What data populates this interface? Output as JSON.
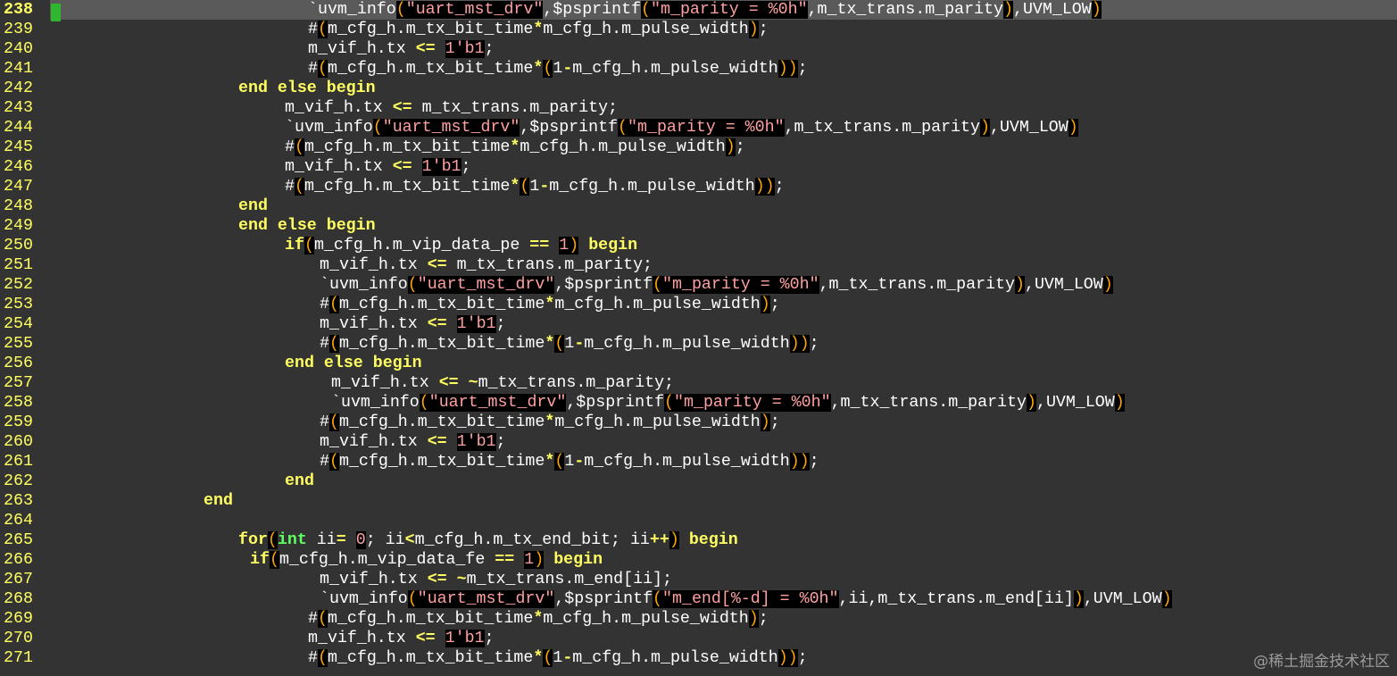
{
  "editor": {
    "current_line": 238,
    "colors": {
      "background": "#333333",
      "current_line_background": "#5a5a5a",
      "line_number": "#ffff60",
      "keyword": "#ffff60",
      "type": "#60ff60",
      "paren": "#ffa500",
      "string": "#ffa0a0",
      "sign_marker": "#2fb82f"
    },
    "lines": [
      {
        "num": "238",
        "indent": 21,
        "tokens": [
          [
            "mac",
            "`uvm_info"
          ],
          [
            "pr",
            "("
          ],
          [
            "str",
            "\"uart_mst_drv\""
          ],
          [
            "",
            "",
            ""
          ],
          [
            "",
            ",$psprintf"
          ],
          [
            "pr",
            "("
          ],
          [
            "str",
            "\"m_parity = %0h\""
          ],
          [
            "",
            ",m_tx_trans.m_parity"
          ],
          [
            "pr",
            ")"
          ],
          [
            "",
            ",UVM_LOW"
          ],
          [
            "pr",
            ")"
          ]
        ]
      },
      {
        "num": "239",
        "indent": 21,
        "tokens": [
          [
            "",
            "#"
          ],
          [
            "pr",
            "("
          ],
          [
            "",
            "m_cfg_h.m_tx_bit_time"
          ],
          [
            "op",
            "*"
          ],
          [
            "",
            "m_cfg_h.m_pulse_width"
          ],
          [
            "pr",
            ")"
          ],
          [
            "",
            ";"
          ]
        ]
      },
      {
        "num": "240",
        "indent": 21,
        "tokens": [
          [
            "",
            "m_vif_h.tx "
          ],
          [
            "op",
            "<="
          ],
          [
            "",
            ""
          ],
          [
            "",
            " "
          ],
          [
            "num",
            "1'b1"
          ],
          [
            "",
            ";"
          ]
        ]
      },
      {
        "num": "241",
        "indent": 21,
        "tokens": [
          [
            "",
            "#"
          ],
          [
            "pr",
            "("
          ],
          [
            "",
            "m_cfg_h.m_tx_bit_time"
          ],
          [
            "op",
            "*"
          ],
          [
            "pr",
            "("
          ],
          [
            "",
            "1"
          ],
          [
            "op",
            "-"
          ],
          [
            "",
            "m_cfg_h.m_pulse_width"
          ],
          [
            "pr",
            "))"
          ],
          [
            "",
            ";"
          ]
        ]
      },
      {
        "num": "242",
        "indent": 15,
        "tokens": [
          [
            "kw",
            "end else begin"
          ]
        ]
      },
      {
        "num": "243",
        "indent": 19,
        "tokens": [
          [
            "",
            "m_vif_h.tx "
          ],
          [
            "op",
            "<="
          ],
          [
            "",
            " m_tx_trans.m_parity;"
          ]
        ]
      },
      {
        "num": "244",
        "indent": 19,
        "tokens": [
          [
            "mac",
            "`uvm_info"
          ],
          [
            "pr",
            "("
          ],
          [
            "str",
            "\"uart_mst_drv\""
          ],
          [
            "",
            ",$psprintf"
          ],
          [
            "pr",
            "("
          ],
          [
            "str",
            "\"m_parity = %0h\""
          ],
          [
            "",
            ",m_tx_trans.m_parity"
          ],
          [
            "pr",
            ")"
          ],
          [
            "",
            ",UVM_LOW"
          ],
          [
            "pr",
            ")"
          ]
        ]
      },
      {
        "num": "245",
        "indent": 19,
        "tokens": [
          [
            "",
            "#"
          ],
          [
            "pr",
            "("
          ],
          [
            "",
            "m_cfg_h.m_tx_bit_time"
          ],
          [
            "op",
            "*"
          ],
          [
            "",
            "m_cfg_h.m_pulse_width"
          ],
          [
            "pr",
            ")"
          ],
          [
            "",
            ";"
          ]
        ]
      },
      {
        "num": "246",
        "indent": 19,
        "tokens": [
          [
            "",
            "m_vif_h.tx "
          ],
          [
            "op",
            "<="
          ],
          [
            "",
            " "
          ],
          [
            "num",
            "1'b1"
          ],
          [
            "",
            ";"
          ]
        ]
      },
      {
        "num": "247",
        "indent": 19,
        "tokens": [
          [
            "",
            "#"
          ],
          [
            "pr",
            "("
          ],
          [
            "",
            "m_cfg_h.m_tx_bit_time"
          ],
          [
            "op",
            "*"
          ],
          [
            "pr",
            "("
          ],
          [
            "",
            "1"
          ],
          [
            "op",
            "-"
          ],
          [
            "",
            "m_cfg_h.m_pulse_width"
          ],
          [
            "pr",
            "))"
          ],
          [
            "",
            ";"
          ]
        ]
      },
      {
        "num": "248",
        "indent": 15,
        "tokens": [
          [
            "kw",
            "end"
          ]
        ]
      },
      {
        "num": "249",
        "indent": 15,
        "tokens": [
          [
            "kw",
            "end else begin"
          ]
        ]
      },
      {
        "num": "250",
        "indent": 19,
        "tokens": [
          [
            "kw",
            "if"
          ],
          [
            "pr",
            "("
          ],
          [
            "",
            "m_cfg_h.m_vip_data_pe "
          ],
          [
            "op",
            "=="
          ],
          [
            "",
            " "
          ],
          [
            "num",
            "1"
          ],
          [
            "pr",
            ")"
          ],
          [
            "",
            " "
          ],
          [
            "kw",
            "begin"
          ]
        ]
      },
      {
        "num": "251",
        "indent": 22,
        "tokens": [
          [
            "",
            "m_vif_h.tx "
          ],
          [
            "op",
            "<="
          ],
          [
            "",
            " m_tx_trans.m_parity;"
          ]
        ]
      },
      {
        "num": "252",
        "indent": 22,
        "tokens": [
          [
            "mac",
            "`uvm_info"
          ],
          [
            "pr",
            "("
          ],
          [
            "str",
            "\"uart_mst_drv\""
          ],
          [
            "",
            ",$psprintf"
          ],
          [
            "pr",
            "("
          ],
          [
            "str",
            "\"m_parity = %0h\""
          ],
          [
            "",
            ",m_tx_trans.m_parity"
          ],
          [
            "pr",
            ")"
          ],
          [
            "",
            ",UVM_LOW"
          ],
          [
            "pr",
            ")"
          ]
        ]
      },
      {
        "num": "253",
        "indent": 22,
        "tokens": [
          [
            "",
            "#"
          ],
          [
            "pr",
            "("
          ],
          [
            "",
            "m_cfg_h.m_tx_bit_time"
          ],
          [
            "op",
            "*"
          ],
          [
            "",
            "m_cfg_h.m_pulse_width"
          ],
          [
            "pr",
            ")"
          ],
          [
            "",
            ";"
          ]
        ]
      },
      {
        "num": "254",
        "indent": 22,
        "tokens": [
          [
            "",
            "m_vif_h.tx "
          ],
          [
            "op",
            "<="
          ],
          [
            "",
            " "
          ],
          [
            "num",
            "1'b1"
          ],
          [
            "",
            ";"
          ]
        ]
      },
      {
        "num": "255",
        "indent": 22,
        "tokens": [
          [
            "",
            "#"
          ],
          [
            "pr",
            "("
          ],
          [
            "",
            "m_cfg_h.m_tx_bit_time"
          ],
          [
            "op",
            "*"
          ],
          [
            "pr",
            "("
          ],
          [
            "",
            "1"
          ],
          [
            "op",
            "-"
          ],
          [
            "",
            "m_cfg_h.m_pulse_width"
          ],
          [
            "pr",
            "))"
          ],
          [
            "",
            ";"
          ]
        ]
      },
      {
        "num": "256",
        "indent": 19,
        "tokens": [
          [
            "kw",
            "end else begin"
          ]
        ]
      },
      {
        "num": "257",
        "indent": 23,
        "tokens": [
          [
            "",
            "m_vif_h.tx "
          ],
          [
            "op",
            "<="
          ],
          [
            "",
            " "
          ],
          [
            "op",
            "~"
          ],
          [
            "",
            "m_tx_trans.m_parity;"
          ]
        ]
      },
      {
        "num": "258",
        "indent": 23,
        "tokens": [
          [
            "mac",
            "`uvm_info"
          ],
          [
            "pr",
            "("
          ],
          [
            "str",
            "\"uart_mst_drv\""
          ],
          [
            "",
            ",$psprintf"
          ],
          [
            "pr",
            "("
          ],
          [
            "str",
            "\"m_parity = %0h\""
          ],
          [
            "",
            ",m_tx_trans.m_parity"
          ],
          [
            "pr",
            ")"
          ],
          [
            "",
            ",UVM_LOW"
          ],
          [
            "pr",
            ")"
          ]
        ]
      },
      {
        "num": "259",
        "indent": 22,
        "tokens": [
          [
            "",
            "#"
          ],
          [
            "pr",
            "("
          ],
          [
            "",
            "m_cfg_h.m_tx_bit_time"
          ],
          [
            "op",
            "*"
          ],
          [
            "",
            "m_cfg_h.m_pulse_width"
          ],
          [
            "pr",
            ")"
          ],
          [
            "",
            ";"
          ]
        ]
      },
      {
        "num": "260",
        "indent": 22,
        "tokens": [
          [
            "",
            "m_vif_h.tx "
          ],
          [
            "op",
            "<="
          ],
          [
            "",
            " "
          ],
          [
            "num",
            "1'b1"
          ],
          [
            "",
            ";"
          ]
        ]
      },
      {
        "num": "261",
        "indent": 22,
        "tokens": [
          [
            "",
            "#"
          ],
          [
            "pr",
            "("
          ],
          [
            "",
            "m_cfg_h.m_tx_bit_time"
          ],
          [
            "op",
            "*"
          ],
          [
            "pr",
            "("
          ],
          [
            "",
            "1"
          ],
          [
            "op",
            "-"
          ],
          [
            "",
            "m_cfg_h.m_pulse_width"
          ],
          [
            "pr",
            "))"
          ],
          [
            "",
            ";"
          ]
        ]
      },
      {
        "num": "262",
        "indent": 19,
        "tokens": [
          [
            "kw",
            "end"
          ]
        ]
      },
      {
        "num": "263",
        "indent": 12,
        "tokens": [
          [
            "kw",
            "end"
          ]
        ]
      },
      {
        "num": "264",
        "indent": 0,
        "tokens": []
      },
      {
        "num": "265",
        "indent": 15,
        "tokens": [
          [
            "kw",
            "for"
          ],
          [
            "pr",
            "("
          ],
          [
            "ty",
            "int"
          ],
          [
            "",
            " ii"
          ],
          [
            "op",
            "="
          ],
          [
            "",
            " "
          ],
          [
            "num",
            "0"
          ],
          [
            "",
            ";"
          ],
          [
            "",
            " ii"
          ],
          [
            "op",
            "<"
          ],
          [
            "",
            "m_cfg_h.m_tx_end_bit; ii"
          ],
          [
            "op",
            "++"
          ],
          [
            "pr",
            ")"
          ],
          [
            "",
            " "
          ],
          [
            "kw",
            "begin"
          ]
        ]
      },
      {
        "num": "266",
        "indent": 16,
        "tokens": [
          [
            "kw",
            "if"
          ],
          [
            "pr",
            "("
          ],
          [
            "",
            "m_cfg_h.m_vip_data_fe "
          ],
          [
            "op",
            "=="
          ],
          [
            "",
            " "
          ],
          [
            "num",
            "1"
          ],
          [
            "pr",
            ")"
          ],
          [
            "",
            " "
          ],
          [
            "kw",
            "begin"
          ]
        ]
      },
      {
        "num": "267",
        "indent": 22,
        "tokens": [
          [
            "",
            "m_vif_h.tx "
          ],
          [
            "op",
            "<="
          ],
          [
            "",
            " "
          ],
          [
            "op",
            "~"
          ],
          [
            "",
            "m_tx_trans.m_end[ii];"
          ]
        ]
      },
      {
        "num": "268",
        "indent": 22,
        "tokens": [
          [
            "mac",
            "`uvm_info"
          ],
          [
            "pr",
            "("
          ],
          [
            "str",
            "\"uart_mst_drv\""
          ],
          [
            "",
            ",$psprintf"
          ],
          [
            "pr",
            "("
          ],
          [
            "str",
            "\"m_end[%-d] = %0h\""
          ],
          [
            "",
            ",ii,m_tx_trans.m_end[ii]"
          ],
          [
            "pr",
            ")"
          ],
          [
            "",
            ",UVM_LOW"
          ],
          [
            "pr",
            ")"
          ]
        ]
      },
      {
        "num": "269",
        "indent": 21,
        "tokens": [
          [
            "",
            "#"
          ],
          [
            "pr",
            "("
          ],
          [
            "",
            "m_cfg_h.m_tx_bit_time"
          ],
          [
            "op",
            "*"
          ],
          [
            "",
            "m_cfg_h.m_pulse_width"
          ],
          [
            "pr",
            ")"
          ],
          [
            "",
            ";"
          ]
        ]
      },
      {
        "num": "270",
        "indent": 21,
        "tokens": [
          [
            "",
            "m_vif_h.tx "
          ],
          [
            "op",
            "<="
          ],
          [
            "",
            " "
          ],
          [
            "num",
            "1'b1"
          ],
          [
            "",
            ";"
          ]
        ]
      },
      {
        "num": "271",
        "indent": 21,
        "tokens": [
          [
            "",
            "#"
          ],
          [
            "pr",
            "("
          ],
          [
            "",
            "m_cfg_h.m_tx_bit_time"
          ],
          [
            "op",
            "*"
          ],
          [
            "pr",
            "("
          ],
          [
            "",
            "1"
          ],
          [
            "op",
            "-"
          ],
          [
            "",
            "m_cfg_h.m_pulse_width"
          ],
          [
            "pr",
            "))"
          ],
          [
            "",
            ";"
          ]
        ]
      }
    ]
  },
  "watermark": "@稀土掘金技术社区"
}
